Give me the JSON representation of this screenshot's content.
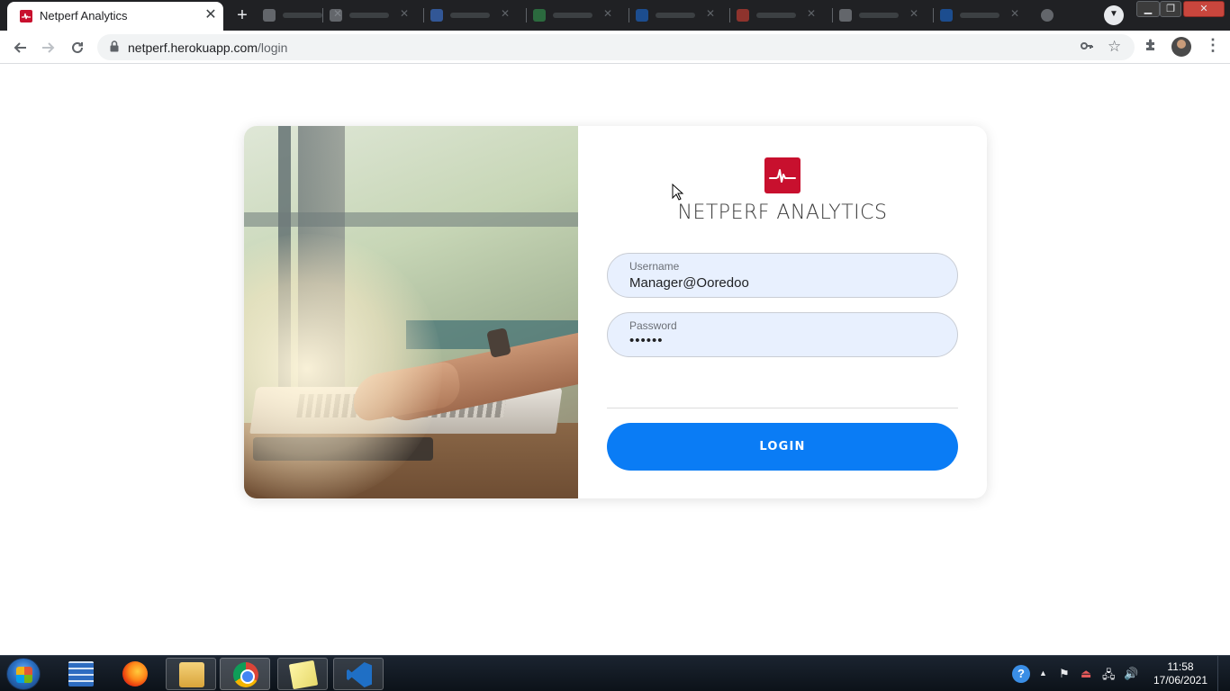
{
  "browser": {
    "tab_title": "Netperf Analytics",
    "tab_close": "✕",
    "new_tab": "+",
    "url_host": "netperf.herokuapp.com",
    "url_path": "/login",
    "icons": {
      "back": "back-arrow-icon",
      "forward": "forward-arrow-icon",
      "reload": "reload-icon",
      "lock": "lock-icon",
      "key": "key-icon",
      "star": "bookmark-star-icon",
      "extensions": "puzzle-icon",
      "menu": "kebab-menu-icon"
    }
  },
  "login": {
    "brand_name": "NETPERF ANALYTICS",
    "username_label": "Username",
    "username_value": "Manager@Ooredoo",
    "password_label": "Password",
    "password_value": "••••••",
    "login_button": "LOGIN"
  },
  "taskbar": {
    "time": "11:58",
    "date": "17/06/2021"
  },
  "colors": {
    "brand_red": "#c8102e",
    "login_button": "#0a7cf5",
    "field_bg": "#e8f0fe",
    "tab_strip": "#202124"
  }
}
